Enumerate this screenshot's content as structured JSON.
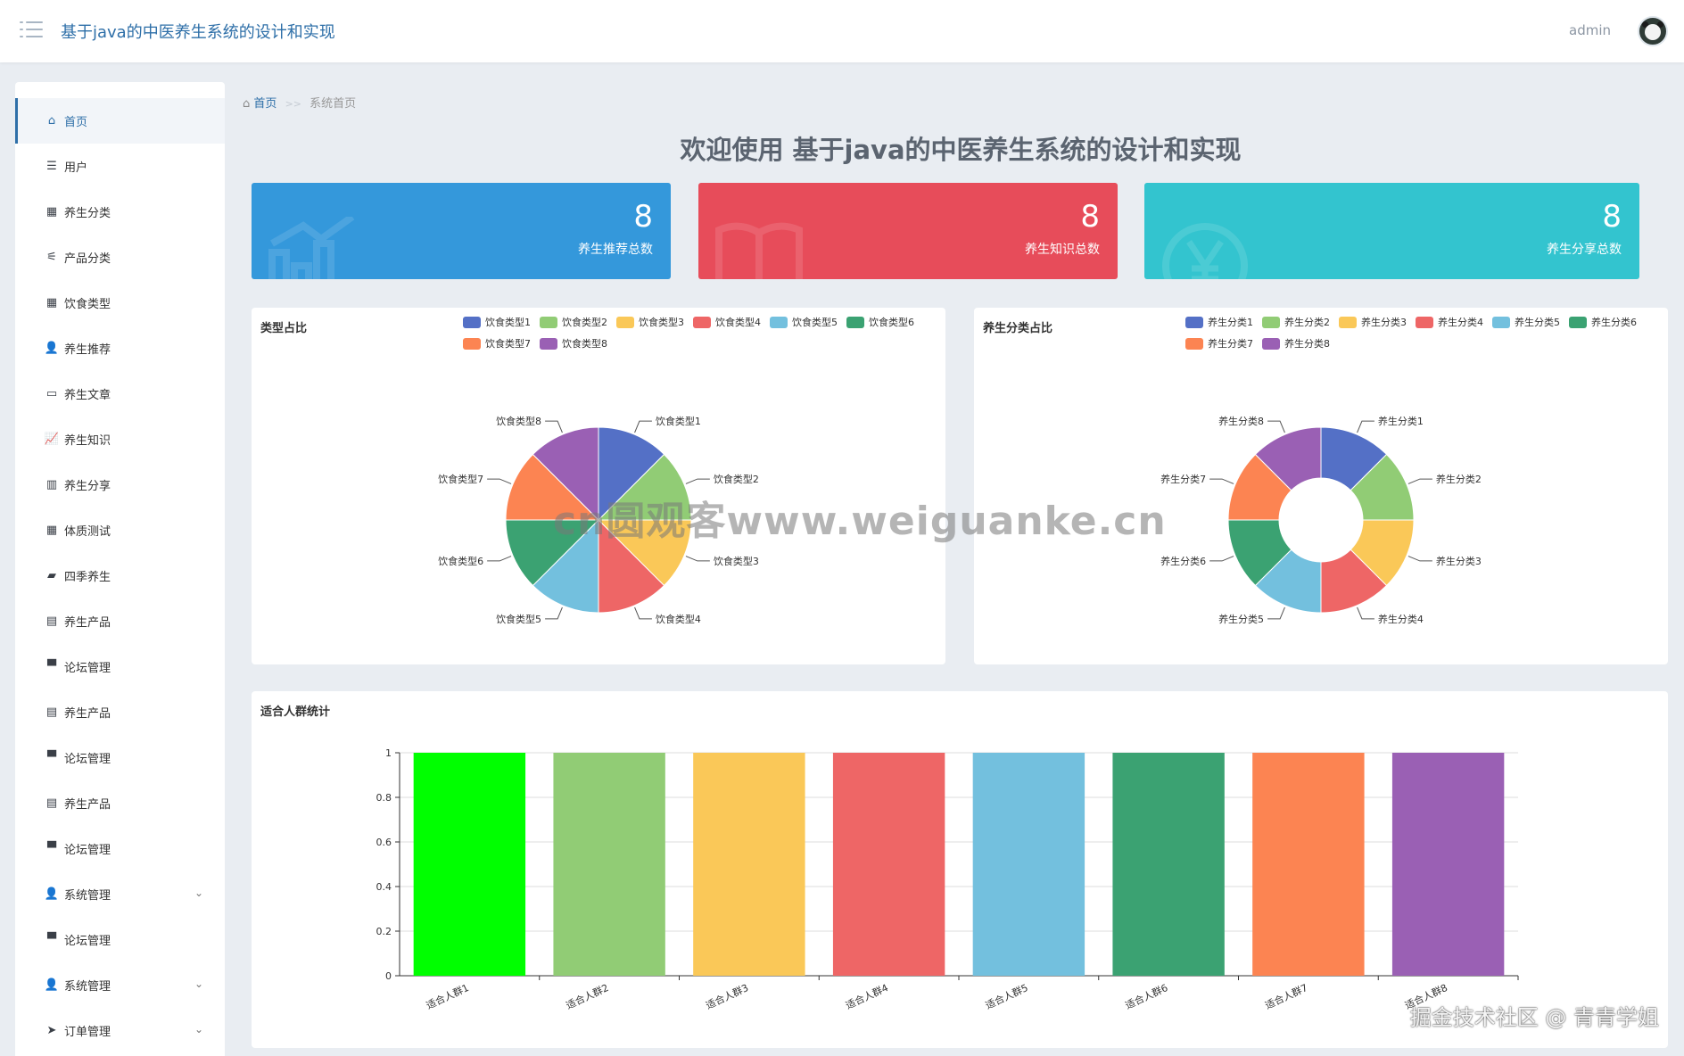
{
  "header": {
    "title": "基于java的中医养生系统的设计和实现",
    "user": "admin"
  },
  "sidebar": {
    "items": [
      {
        "label": "首页",
        "icon": "home-icon",
        "active": true,
        "expandable": false
      },
      {
        "label": "用户",
        "icon": "list-icon",
        "active": false,
        "expandable": false
      },
      {
        "label": "养生分类",
        "icon": "grid-icon",
        "active": false,
        "expandable": false
      },
      {
        "label": "产品分类",
        "icon": "sliders-icon",
        "active": false,
        "expandable": false
      },
      {
        "label": "饮食类型",
        "icon": "grid-icon",
        "active": false,
        "expandable": false
      },
      {
        "label": "养生推荐",
        "icon": "user-icon",
        "active": false,
        "expandable": false
      },
      {
        "label": "养生文章",
        "icon": "monitor-icon",
        "active": false,
        "expandable": false
      },
      {
        "label": "养生知识",
        "icon": "chart-icon",
        "active": false,
        "expandable": false
      },
      {
        "label": "养生分享",
        "icon": "books-icon",
        "active": false,
        "expandable": false
      },
      {
        "label": "体质测试",
        "icon": "grid-icon",
        "active": false,
        "expandable": false
      },
      {
        "label": "四季养生",
        "icon": "wallet-icon",
        "active": false,
        "expandable": false
      },
      {
        "label": "养生产品",
        "icon": "clipboard-icon",
        "active": false,
        "expandable": false
      },
      {
        "label": "论坛管理",
        "icon": "paint-roller-icon",
        "active": false,
        "expandable": false
      },
      {
        "label": "养生产品",
        "icon": "clipboard-icon",
        "active": false,
        "expandable": false
      },
      {
        "label": "论坛管理",
        "icon": "paint-roller-icon",
        "active": false,
        "expandable": false
      },
      {
        "label": "养生产品",
        "icon": "clipboard-icon",
        "active": false,
        "expandable": false
      },
      {
        "label": "论坛管理",
        "icon": "paint-roller-icon",
        "active": false,
        "expandable": false
      },
      {
        "label": "系统管理",
        "icon": "user-icon",
        "active": false,
        "expandable": true
      },
      {
        "label": "论坛管理",
        "icon": "paint-roller-icon",
        "active": false,
        "expandable": false
      },
      {
        "label": "系统管理",
        "icon": "user-icon",
        "active": false,
        "expandable": true
      },
      {
        "label": "订单管理",
        "icon": "send-icon",
        "active": false,
        "expandable": true
      }
    ]
  },
  "breadcrumb": {
    "home": "首页",
    "separator": ">>",
    "current": "系统首页"
  },
  "welcome": "欢迎使用 基于java的中医养生系统的设计和实现",
  "stats": [
    {
      "value": "8",
      "label": "养生推荐总数",
      "color": "#3498db",
      "icon": "chart-up-icon"
    },
    {
      "value": "8",
      "label": "养生知识总数",
      "color": "#e74c5a",
      "icon": "book-icon"
    },
    {
      "value": "8",
      "label": "养生分享总数",
      "color": "#33c4cf",
      "icon": "yen-icon"
    }
  ],
  "palette": [
    "#5470c6",
    "#91cc75",
    "#fac858",
    "#ee6666",
    "#73c0de",
    "#3ba272",
    "#fc8452",
    "#9a60b4"
  ],
  "chart_data": [
    {
      "type": "pie",
      "title": "类型占比",
      "legend_position": "top-right",
      "categories": [
        "饮食类型1",
        "饮食类型2",
        "饮食类型3",
        "饮食类型4",
        "饮食类型5",
        "饮食类型6",
        "饮食类型7",
        "饮食类型8"
      ],
      "values": [
        1,
        1,
        1,
        1,
        1,
        1,
        1,
        1
      ]
    },
    {
      "type": "pie",
      "variant": "donut",
      "title": "养生分类占比",
      "legend_position": "top-right",
      "categories": [
        "养生分类1",
        "养生分类2",
        "养生分类3",
        "养生分类4",
        "养生分类5",
        "养生分类6",
        "养生分类7",
        "养生分类8"
      ],
      "values": [
        1,
        1,
        1,
        1,
        1,
        1,
        1,
        1
      ]
    },
    {
      "type": "bar",
      "title": "适合人群统计",
      "categories": [
        "适合人群1",
        "适合人群2",
        "适合人群3",
        "适合人群4",
        "适合人群5",
        "适合人群6",
        "适合人群7",
        "适合人群8"
      ],
      "values": [
        1,
        1,
        1,
        1,
        1,
        1,
        1,
        1
      ],
      "ylim": [
        0,
        1
      ],
      "yticks": [
        "0",
        "0.2",
        "0.4",
        "0.6",
        "0.8",
        "1"
      ],
      "bar_colors": [
        "#00ff00",
        "#91cc75",
        "#fac858",
        "#ee6666",
        "#73c0de",
        "#3ba272",
        "#fc8452",
        "#9a60b4"
      ],
      "grid": true
    }
  ],
  "watermarks": {
    "center": "cn圆观客www.weiguanke.cn",
    "corner": "掘金技术社区 @ 青青学姐"
  }
}
